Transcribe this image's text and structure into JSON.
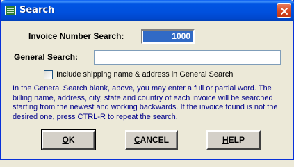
{
  "window": {
    "title": "Search",
    "icon": "search-dialog-icon",
    "close_icon": "close-icon"
  },
  "invoice_search": {
    "label_access": "I",
    "label_rest": "nvoice Number Search:",
    "value": "1000"
  },
  "general_search": {
    "label_access": "G",
    "label_rest": "eneral Search:",
    "value": ""
  },
  "include_shipping": {
    "label": "Include shipping name & address in General Search",
    "checked": false
  },
  "info_text": "In the General Search blank, above, you may enter a full or partial word.  The billing name, address, city, state and country of each invoice will be searched starting from the newest and working backwards.  If the invoice found is not the desired one, press CTRL-R to repeat the search.",
  "buttons": {
    "ok_access": "O",
    "ok_rest": "K",
    "cancel_access": "C",
    "cancel_rest": "ANCEL",
    "help_access": "H",
    "help_rest": "ELP"
  },
  "colors": {
    "titlebar": "#0054E3",
    "info_text": "#00008B",
    "selection": "#316AC5",
    "dialog_bg": "#ECE9D8"
  }
}
